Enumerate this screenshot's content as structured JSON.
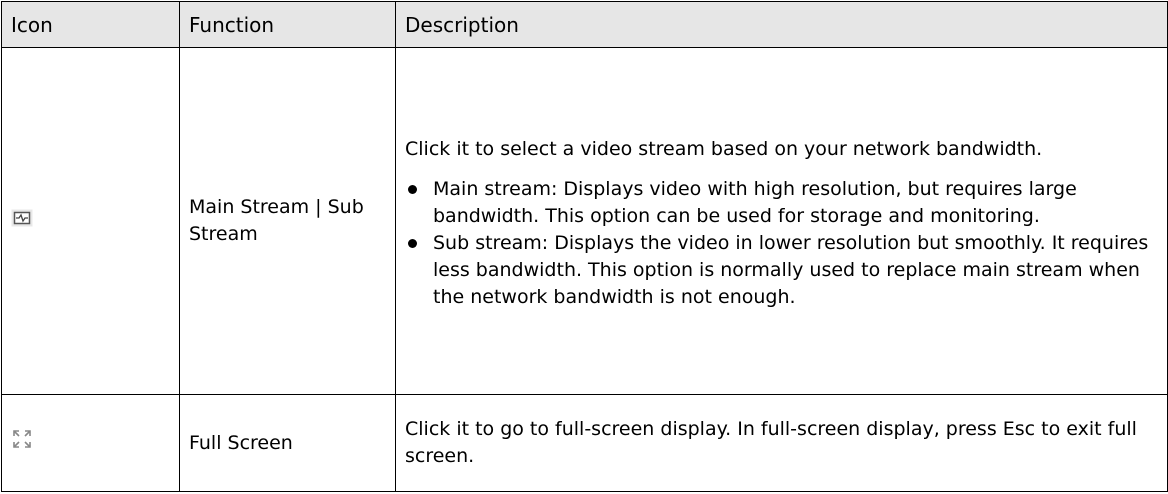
{
  "table": {
    "headers": [
      "Icon",
      "Function",
      "Description"
    ],
    "rows": [
      {
        "icon": "stream-switch-icon",
        "function": "Main Stream | Sub Stream",
        "description_intro": "Click it to select a video stream based on your network bandwidth.",
        "bullets": [
          "Main stream: Displays video with high resolution, but requires large bandwidth. This option can be used for storage and monitoring.",
          "Sub stream: Displays the video in lower resolution but smoothly. It requires less bandwidth. This option is normally used to replace main stream when the network bandwidth is not enough."
        ]
      },
      {
        "icon": "fullscreen-icon",
        "function": "Full Screen",
        "description": "Click it to go to full-screen display. In full-screen display, press Esc to exit full screen."
      }
    ]
  }
}
